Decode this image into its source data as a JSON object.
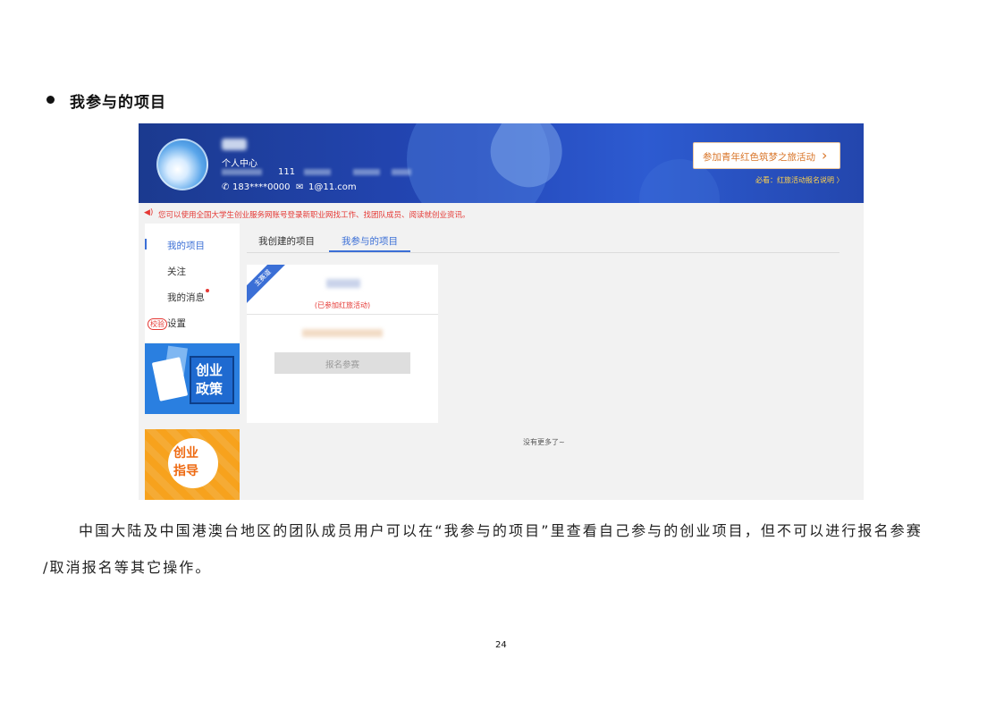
{
  "document": {
    "heading": "我参与的项目",
    "paragraph_line1": "中国大陆及中国港澳台地区的团队成员用户可以在“我参与的项目”里查看自己参与的创业项目，但不可以进行报名参赛",
    "paragraph_line2": "/取消报名等其它操作。",
    "page_number": "24"
  },
  "screenshot": {
    "header": {
      "center_label": "个人中心",
      "count_value": "111",
      "phone": "183****0000",
      "email": "1@11.com",
      "join_button": "参加青年红色筑梦之旅活动",
      "note": "必看：红旅活动报名说明 〉"
    },
    "notice": "您可以使用全国大学生创业服务网账号登录新职业网找工作、找团队成员、阅读就创业资讯。",
    "sidebar": {
      "items": [
        "我的项目",
        "关注",
        "我的消息",
        "设置"
      ],
      "settings_badge": "校验",
      "banner1_text": [
        "创业",
        "政策"
      ],
      "banner2_text": [
        "创业",
        "指导"
      ]
    },
    "tabs": [
      "我创建的项目",
      "我参与的项目"
    ],
    "active_tab_index": 1,
    "project_card": {
      "ribbon": "主赛道",
      "status": "(已参加红旅活动)",
      "signup_button": "报名参赛"
    },
    "no_more": "没有更多了~"
  },
  "colors": {
    "accent": "#3b6fd6",
    "banner": "#2447b8",
    "warning": "#e53935",
    "orange": "#d9762a"
  }
}
